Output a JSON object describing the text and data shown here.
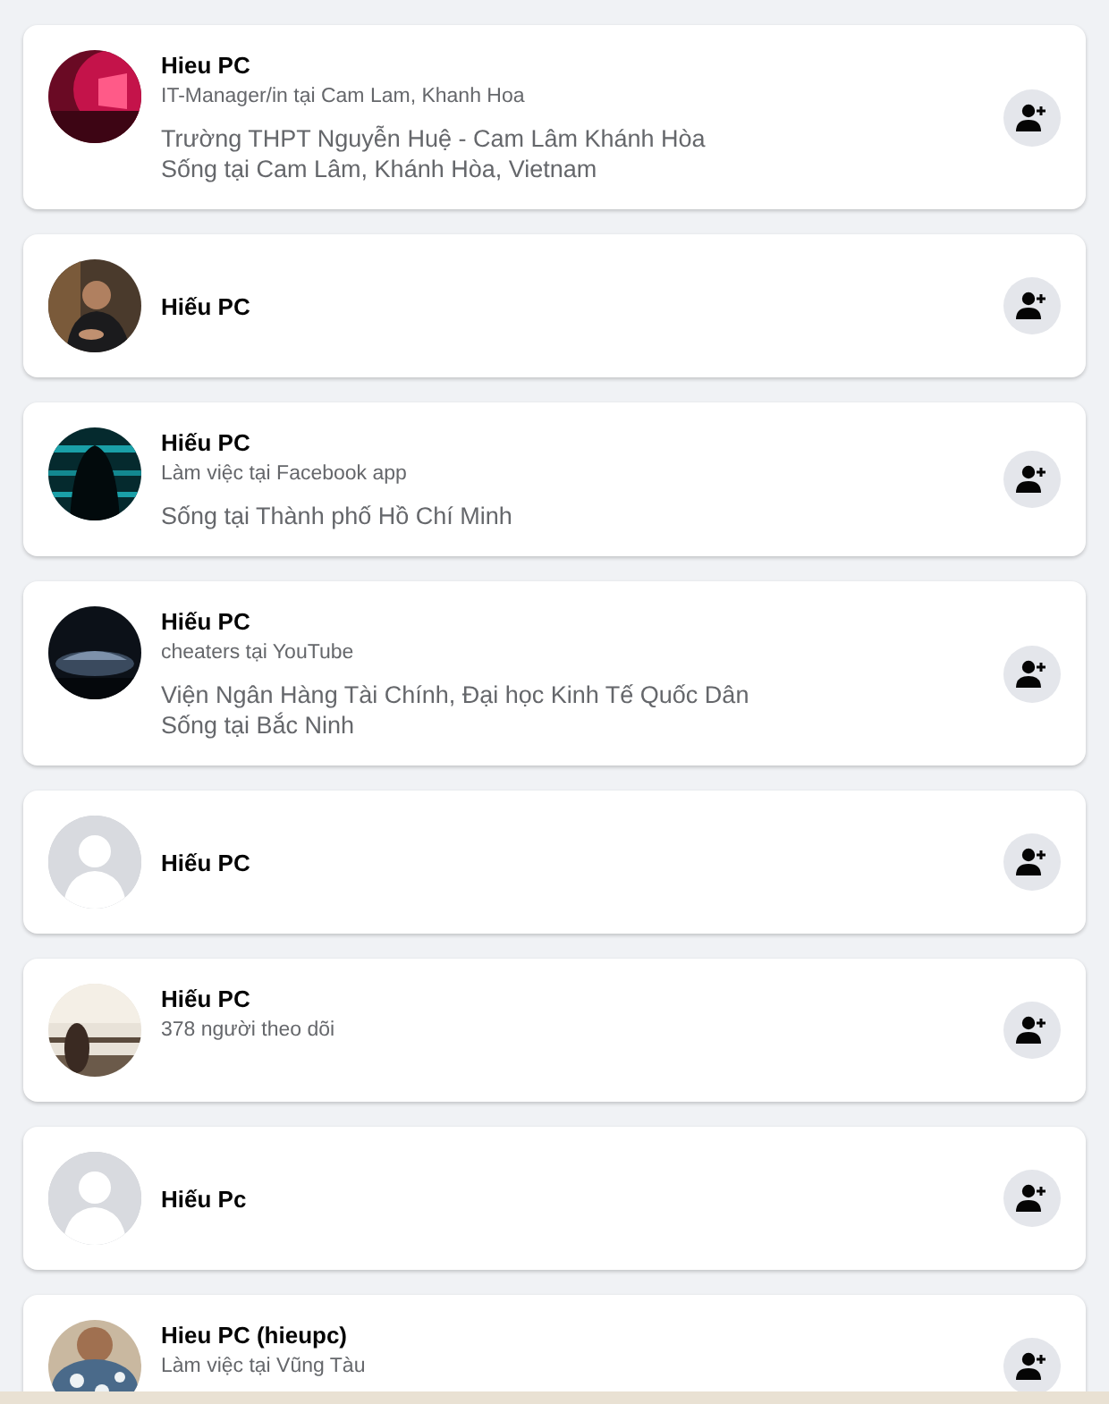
{
  "results": [
    {
      "name": "Hieu PC",
      "avatar": {
        "kind": "picture"
      },
      "subtitle": "IT-Manager/in tại Cam Lam, Khanh Hoa",
      "details": [
        "Trường THPT Nguyễn Huệ - Cam Lâm Khánh Hòa",
        "Sống tại Cam Lâm, Khánh Hòa, Vietnam"
      ]
    },
    {
      "name": "Hiếu PC",
      "avatar": {
        "kind": "picture"
      }
    },
    {
      "name": "Hiếu PC",
      "avatar": {
        "kind": "picture"
      },
      "subtitle": "Làm việc tại Facebook app",
      "details": [
        "Sống tại Thành phố Hồ Chí Minh"
      ]
    },
    {
      "name": "Hiếu PC",
      "avatar": {
        "kind": "picture"
      },
      "subtitle": "cheaters tại YouTube",
      "details": [
        "Viện Ngân Hàng Tài Chính, Đại học Kinh Tế Quốc Dân",
        "Sống tại Bắc Ninh"
      ]
    },
    {
      "name": "Hiếu PC",
      "avatar": {
        "kind": "default"
      }
    },
    {
      "name": "Hiếu PC",
      "avatar": {
        "kind": "picture"
      },
      "subtitle": "378 người theo dõi"
    },
    {
      "name": "Hiếu Pc",
      "avatar": {
        "kind": "default"
      }
    },
    {
      "name": "Hieu PC (hieupc)",
      "avatar": {
        "kind": "picture"
      },
      "subtitle": "Làm việc tại Vũng Tàu"
    }
  ]
}
